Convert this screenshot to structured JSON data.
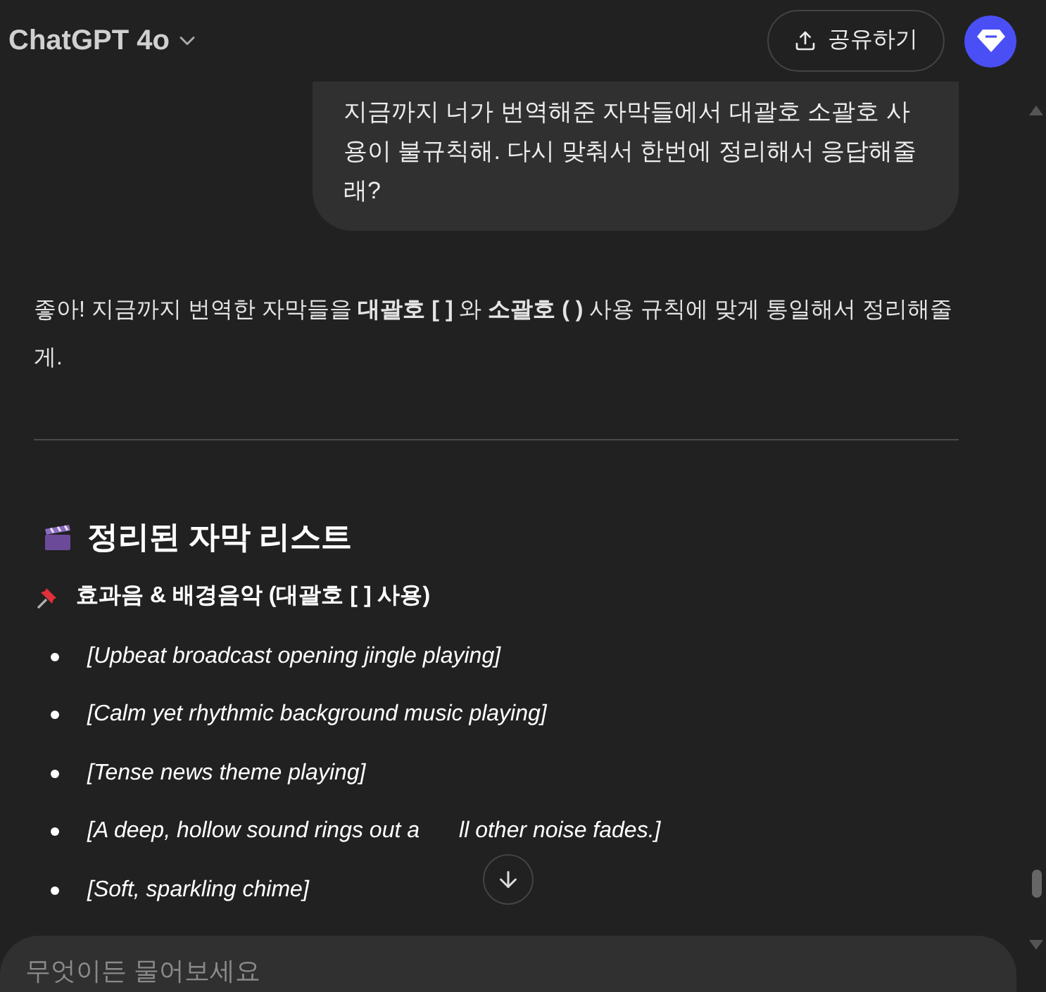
{
  "header": {
    "model": "ChatGPT 4o",
    "share_button": "공유하기"
  },
  "user_message": "지금까지 너가 번역해준 자막들에서 대괄호 소괄호 사용이 불규칙해. 다시 맞춰서 한번에 정리해서 응답해줄래?",
  "assistant": {
    "intro": "좋아! 지금까지 번역한 자막들을 **대괄호 [ ]** 와 **소괄호 ( )** 사용 규칙에 맞게 통일해서 정리해줄게.",
    "heading": "정리된 자막 리스트",
    "subheading": "효과음 & 배경음악 (대괄호 [ ] 사용)",
    "items": [
      {
        "text": "[Upbeat broadcast opening jingle playing]"
      },
      {
        "text": "[Calm yet rhythmic background music playing]"
      },
      {
        "text": "[Tense news theme playing]"
      },
      {
        "text": "[A deep, hollow sound rings out a",
        "text_after": "ll other noise fades.]"
      },
      {
        "text": "[Soft, sparkling chime]"
      }
    ]
  },
  "composer": {
    "placeholder": "무엇이든 물어보세요"
  }
}
